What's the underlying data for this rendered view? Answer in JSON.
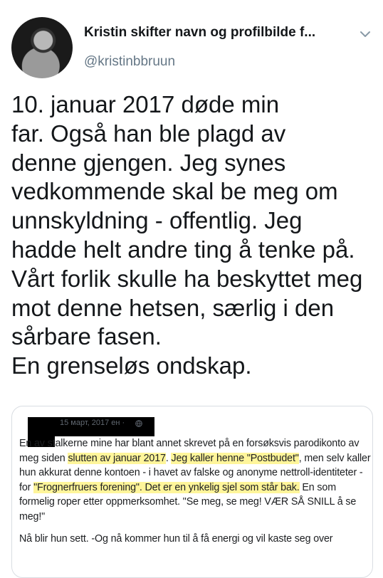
{
  "tweet": {
    "display_name": "Kristin skifter navn og profilbilde f...",
    "handle": "@kristinbbruun",
    "text": "10. januar 2017 døde min\nfar. Også han ble plagd av\ndenne gjengen. Jeg synes\nvedkommende skal be meg om\nunnskyldning - offentlig. Jeg\nhadde helt andre ting å tenke på.\nVårt forlik skulle ha beskyttet meg\nmot denne hetsen, særlig i den\nsårbare fasen.\nEn grenseløs ondskap.",
    "menu_icon": "chevron-down-icon",
    "avatar_icon": "profile-photo"
  },
  "embedded_post": {
    "date": "15 марта 2017 г.",
    "meta_text": "15 март, 2017 ен ·",
    "audience_icon": "globe-icon",
    "paragraph1": [
      {
        "text": "En av stalkerne mine har blant annet skrevet på en forsøksvis parodikonto av meg siden ",
        "hl": false
      },
      {
        "text": "slutten av januar 2017",
        "hl": true
      },
      {
        "text": ". ",
        "hl": false
      },
      {
        "text": "Jeg kaller henne \"Postbudet\"",
        "hl": true
      },
      {
        "text": ", men selv kaller hun akkurat denne kontoen - i havet av falske og anonyme nettroll-identiteter - for ",
        "hl": false
      },
      {
        "text": "\"Frognerfruers forening\". Det er en ynkelig sjel som står bak.",
        "hl": true
      },
      {
        "text": " En som formelig roper etter oppmerksomhet. \"Se meg, se meg! VÆR SÅ SNILL å se meg!\"",
        "hl": false
      }
    ],
    "paragraph2": "Nå blir hun sett. -Og nå kommer hun til å få energi og vil kaste seg over",
    "highlight_color": "#fff59a"
  }
}
